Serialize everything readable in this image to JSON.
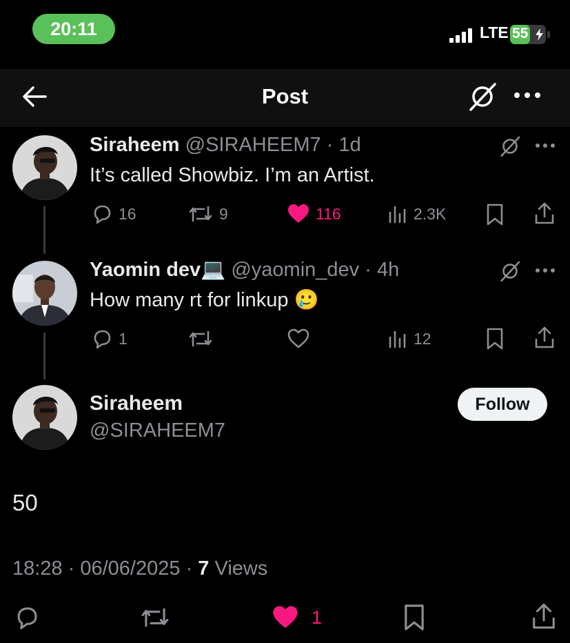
{
  "status_bar": {
    "time": "20:11",
    "network": "LTE",
    "battery": "55",
    "battery_level": 0.55
  },
  "header": {
    "title": "Post"
  },
  "thread": [
    {
      "name": "Siraheem",
      "handle": "@SIRAHEEM7",
      "age": "1d",
      "text": "It’s called Showbiz. I’m an Artist.",
      "replies": "16",
      "reposts": "9",
      "likes": "116",
      "views": "2.3K",
      "liked": true
    },
    {
      "name": "Yaomin dev",
      "name_emoji": "💻",
      "handle": "@yaomin_dev",
      "age": "4h",
      "text": "How many rt for linkup",
      "text_emoji": "🥲",
      "replies": "1",
      "reposts": "",
      "likes": "",
      "views": "12",
      "liked": false
    }
  ],
  "main_post": {
    "name": "Siraheem",
    "handle": "@SIRAHEEM7",
    "follow_label": "Follow",
    "text": "50",
    "time": "18:28",
    "date": "06/06/2025",
    "views_count": "7",
    "views_label": "Views",
    "likes": "1"
  },
  "colors": {
    "like": "#f91880",
    "muted": "#8b8f94",
    "battery_green": "#5ac05a"
  }
}
